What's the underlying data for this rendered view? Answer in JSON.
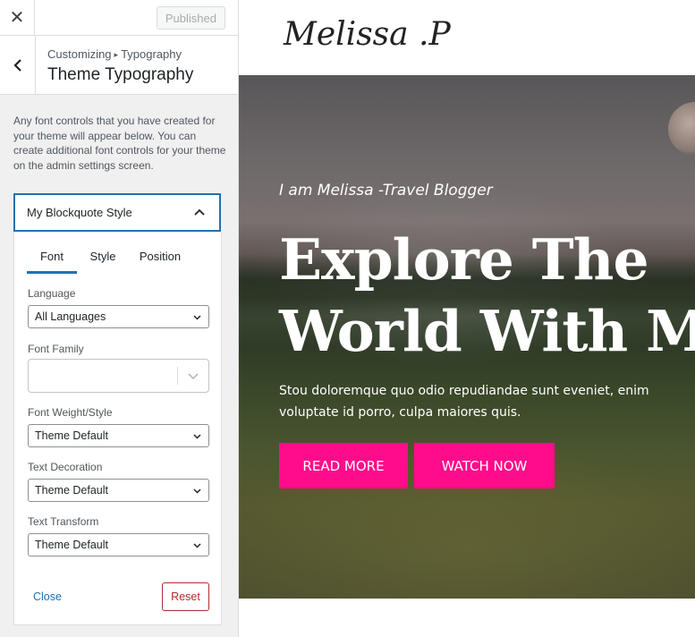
{
  "topbar": {
    "close_glyph": "✕",
    "published_label": "Published"
  },
  "section": {
    "breadcrumb_root": "Customizing",
    "breadcrumb_arrow": "▸",
    "breadcrumb_parent": "Typography",
    "title": "Theme Typography"
  },
  "description": "Any font controls that you have created for your theme will appear below. You can create additional font controls for your theme on the admin settings screen.",
  "control": {
    "name": "My Blockquote Style",
    "tabs": [
      "Font",
      "Style",
      "Position"
    ],
    "active_tab": "Font",
    "fields": {
      "language": {
        "label": "Language",
        "value": "All Languages"
      },
      "font_family": {
        "label": "Font Family",
        "value": ""
      },
      "font_weight": {
        "label": "Font Weight/Style",
        "value": "Theme Default"
      },
      "text_decoration": {
        "label": "Text Decoration",
        "value": "Theme Default"
      },
      "text_transform": {
        "label": "Text Transform",
        "value": "Theme Default"
      }
    },
    "close_label": "Close",
    "reset_label": "Reset"
  },
  "preview": {
    "logo": "Melissa .P",
    "tagline": "I am Melissa -Travel Blogger",
    "headline_line1": "Explore The",
    "headline_line2": "World With Me",
    "subtext": "Stou doloremque quo odio repudiandae sunt eveniet, enim voluptate id porro, culpa maiores quis.",
    "btn_read": "READ MORE",
    "btn_watch": "WATCH NOW"
  },
  "colors": {
    "accent_blue": "#2271b1",
    "cta_pink": "#ff0c8b",
    "reset_red": "#b32d2e",
    "sidebar_bg": "#f0f0f1"
  },
  "icons": {
    "close": "close-icon",
    "back": "chevron-left-icon",
    "collapse": "chevron-up-icon",
    "dropdown": "chevron-down-icon"
  }
}
